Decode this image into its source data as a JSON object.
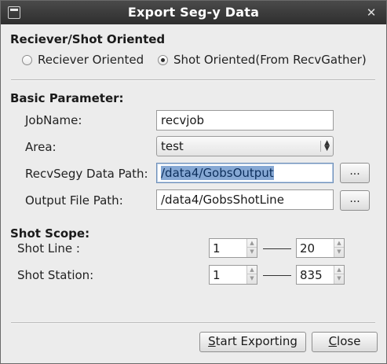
{
  "window": {
    "title": "Export Seg-y Data",
    "close_glyph": "✕"
  },
  "orientation": {
    "section_title": "Reciever/Shot Oriented",
    "options": [
      {
        "label": "Reciever Oriented",
        "checked": false
      },
      {
        "label": "Shot Oriented(From RecvGather)",
        "checked": true
      }
    ]
  },
  "basic": {
    "section_title": "Basic Parameter:",
    "job_name_label": "JobName:",
    "job_name_value": "recvjob",
    "area_label": "Area:",
    "area_value": "test",
    "recv_path_label": "RecvSegy Data Path:",
    "recv_path_value": "/data4/GobsOutput",
    "output_path_label": "Output File Path:",
    "output_path_value": "/data4/GobsShotLine",
    "browse_label": "..."
  },
  "scope": {
    "section_title": "Shot Scope:",
    "shot_line_label": "Shot Line :",
    "shot_line_from": "1",
    "shot_line_to": "20",
    "shot_station_label": "Shot Station:",
    "shot_station_from": "1",
    "shot_station_to": "835"
  },
  "buttons": {
    "start_mnemonic": "S",
    "start_rest": "tart Exporting",
    "close_mnemonic": "C",
    "close_rest": "lose"
  }
}
